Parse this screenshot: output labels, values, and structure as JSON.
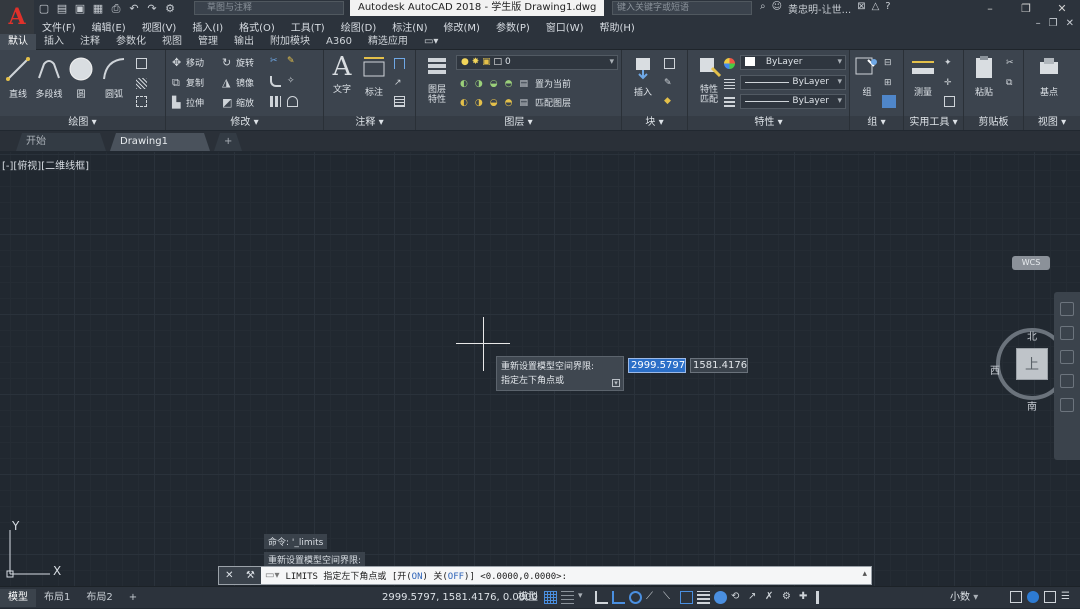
{
  "titlebar": {
    "workspace_placeholder": "草图与注释",
    "title": "Autodesk AutoCAD 2018 - 学生版    Drawing1.dwg",
    "search_placeholder": "键入关键字或短语",
    "user": "黄忠明-让世...",
    "logo": "A"
  },
  "menu": {
    "items": [
      "文件(F)",
      "编辑(E)",
      "视图(V)",
      "插入(I)",
      "格式(O)",
      "工具(T)",
      "绘图(D)",
      "标注(N)",
      "修改(M)",
      "参数(P)",
      "窗口(W)",
      "帮助(H)"
    ]
  },
  "ribbon_tabs": [
    "默认",
    "插入",
    "注释",
    "参数化",
    "视图",
    "管理",
    "输出",
    "附加模块",
    "A360",
    "精选应用"
  ],
  "ribbon": {
    "draw": {
      "title": "绘图 ▾",
      "line": "直线",
      "polyline": "多段线",
      "circle": "圆",
      "arc": "圆弧"
    },
    "modify": {
      "title": "修改 ▾",
      "move": "移动",
      "rotate": "旋转",
      "copy": "复制",
      "mirror": "镜像",
      "stretch": "拉伸",
      "scale": "缩放"
    },
    "annotation": {
      "title": "注释 ▾",
      "text": "文字",
      "dimension": "标注"
    },
    "layers": {
      "title": "图层 ▾",
      "props": "图层\n特性",
      "layer_value": "0",
      "set_current": "置为当前",
      "match_layer": "匹配图层"
    },
    "block": {
      "title": "块 ▾",
      "insert": "插入"
    },
    "properties": {
      "title": "特性 ▾",
      "match": "特性\n匹配",
      "color": "ByLayer",
      "linetype": "ByLayer",
      "lineweight": "ByLayer"
    },
    "groups": {
      "title": "组 ▾",
      "group": "组"
    },
    "utilities": {
      "title": "实用工具 ▾",
      "measure": "测量"
    },
    "clipboard": {
      "title": "剪贴板",
      "paste": "粘贴"
    },
    "view": {
      "title": "视图 ▾",
      "base": "基点"
    }
  },
  "file_tabs": [
    "开始",
    "Drawing1",
    "+"
  ],
  "viewport": {
    "label": "[-][俯视][二维线框]",
    "tooltip_line1": "重新设置模型空间界限:",
    "tooltip_line2": "指定左下角点或",
    "coord_x": "2999.5797",
    "coord_y": "1581.4176"
  },
  "viewcube": {
    "north": "北",
    "south": "南",
    "east": "东",
    "west": "西",
    "top": "上",
    "wcs": "WCS"
  },
  "ucs": {
    "x": "X",
    "y": "Y"
  },
  "command": {
    "history1": "命令: '_limits",
    "history2": "重新设置模型空间界限:",
    "prompt_prefix": "LIMITS 指定左下角点或 [",
    "opt_on_label": "开(",
    "opt_on": "ON",
    "opt_off_label": ") 关(",
    "opt_off": "OFF",
    "prompt_suffix": ")] <0.0000,0.0000>:"
  },
  "status": {
    "layout_tabs": [
      "模型",
      "布局1",
      "布局2",
      "+"
    ],
    "coords": "2999.5797, 1581.4176, 0.0000",
    "model": "模型",
    "units": "小数"
  }
}
